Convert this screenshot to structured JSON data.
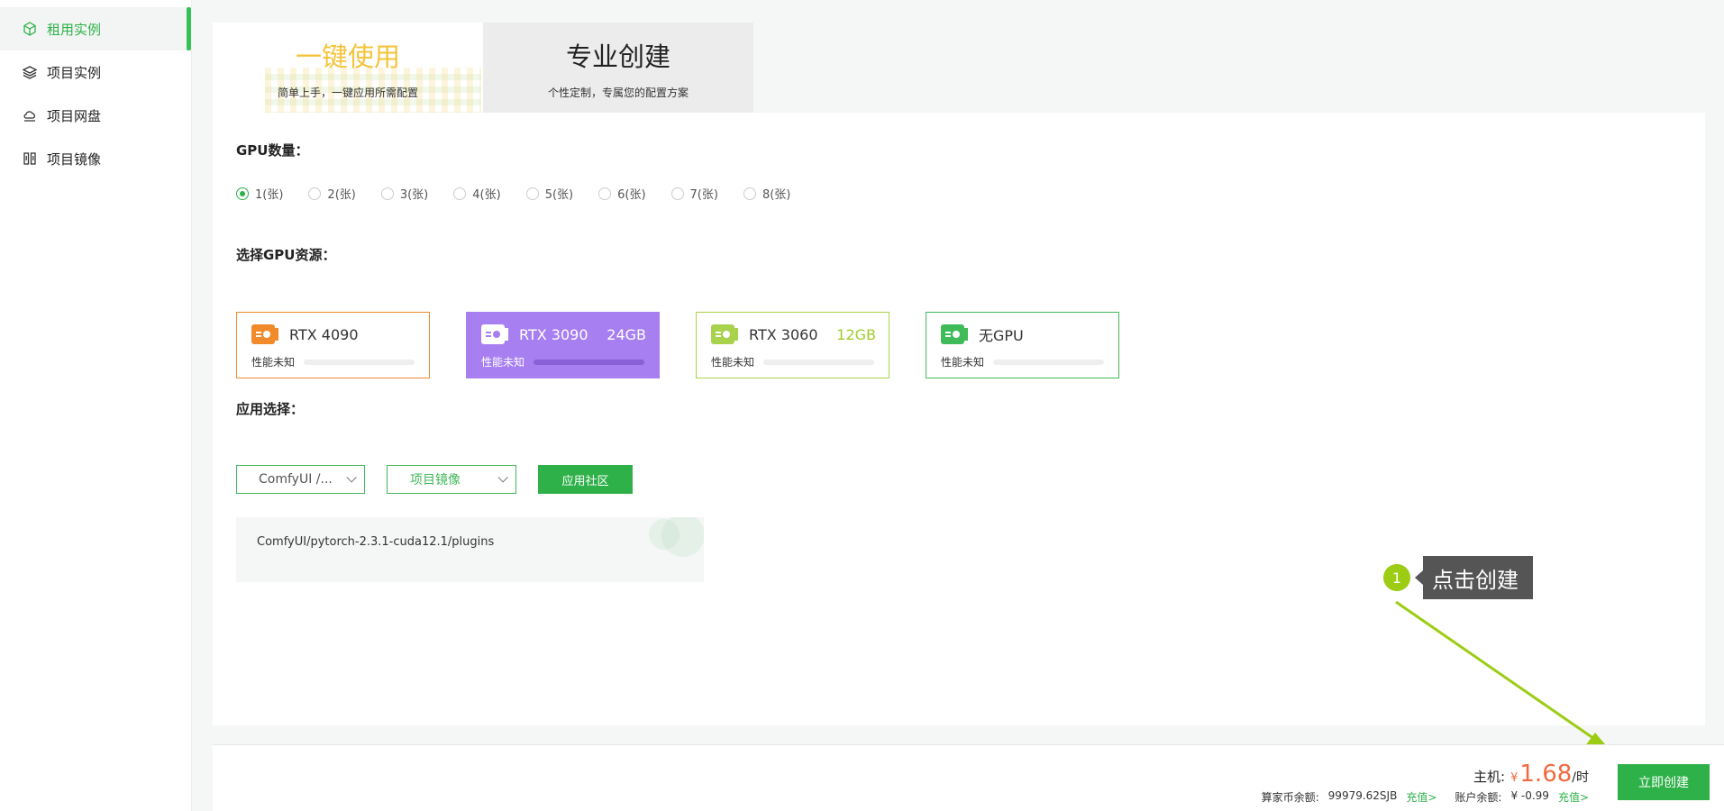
{
  "sidebar": {
    "items": [
      {
        "label": "租用实例",
        "icon": "cube-icon",
        "active": true
      },
      {
        "label": "项目实例",
        "icon": "layers-icon",
        "active": false
      },
      {
        "label": "项目网盘",
        "icon": "cloud-disk-icon",
        "active": false
      },
      {
        "label": "项目镜像",
        "icon": "mirror-icon",
        "active": false
      }
    ]
  },
  "tabs": [
    {
      "title": "一键使用",
      "subtitle": "简单上手，一键应用所需配置"
    },
    {
      "title": "专业创建",
      "subtitle": "个性定制，专属您的配置方案"
    }
  ],
  "gpu_count": {
    "label": "GPU数量：",
    "options": [
      "1(张)",
      "2(张)",
      "3(张)",
      "4(张)",
      "5(张)",
      "6(张)",
      "7(张)",
      "8(张)"
    ],
    "selected": "1(张)"
  },
  "gpu_resource": {
    "label": "选择GPU资源：",
    "cards": [
      {
        "name": "RTX 4090",
        "memory": "",
        "perf": "性能未知",
        "color": "#f08a2a"
      },
      {
        "name": "RTX 3090",
        "memory": "24GB",
        "perf": "性能未知",
        "color": "#a77ff0"
      },
      {
        "name": "RTX 3060",
        "memory": "12GB",
        "perf": "性能未知",
        "color": "#a8d24b"
      },
      {
        "name": "无GPU",
        "memory": "",
        "perf": "性能未知",
        "color": "#3fbb5a"
      }
    ]
  },
  "app": {
    "label": "应用选择：",
    "select1": "ComfyUI /...",
    "select2": "项目镜像",
    "community_button": "应用社区",
    "path": "ComfyUI/pytorch-2.3.1-cuda12.1/plugins"
  },
  "bottom": {
    "host_label": "主机:",
    "currency": "¥",
    "price": "1.68",
    "unit": "/时",
    "coin_label": "算家币余额:",
    "coin_value": "99979.62SJB",
    "recharge1": "充值>",
    "account_label": "账户余额:",
    "account_value": "¥ -0.99",
    "recharge2": "充值>",
    "create_button": "立即创建"
  },
  "annotation": {
    "number": "1",
    "text": "点击创建"
  },
  "colors": {
    "primary": "#2fb14a",
    "price": "#f06a40",
    "annotation": "#9ccc14"
  }
}
